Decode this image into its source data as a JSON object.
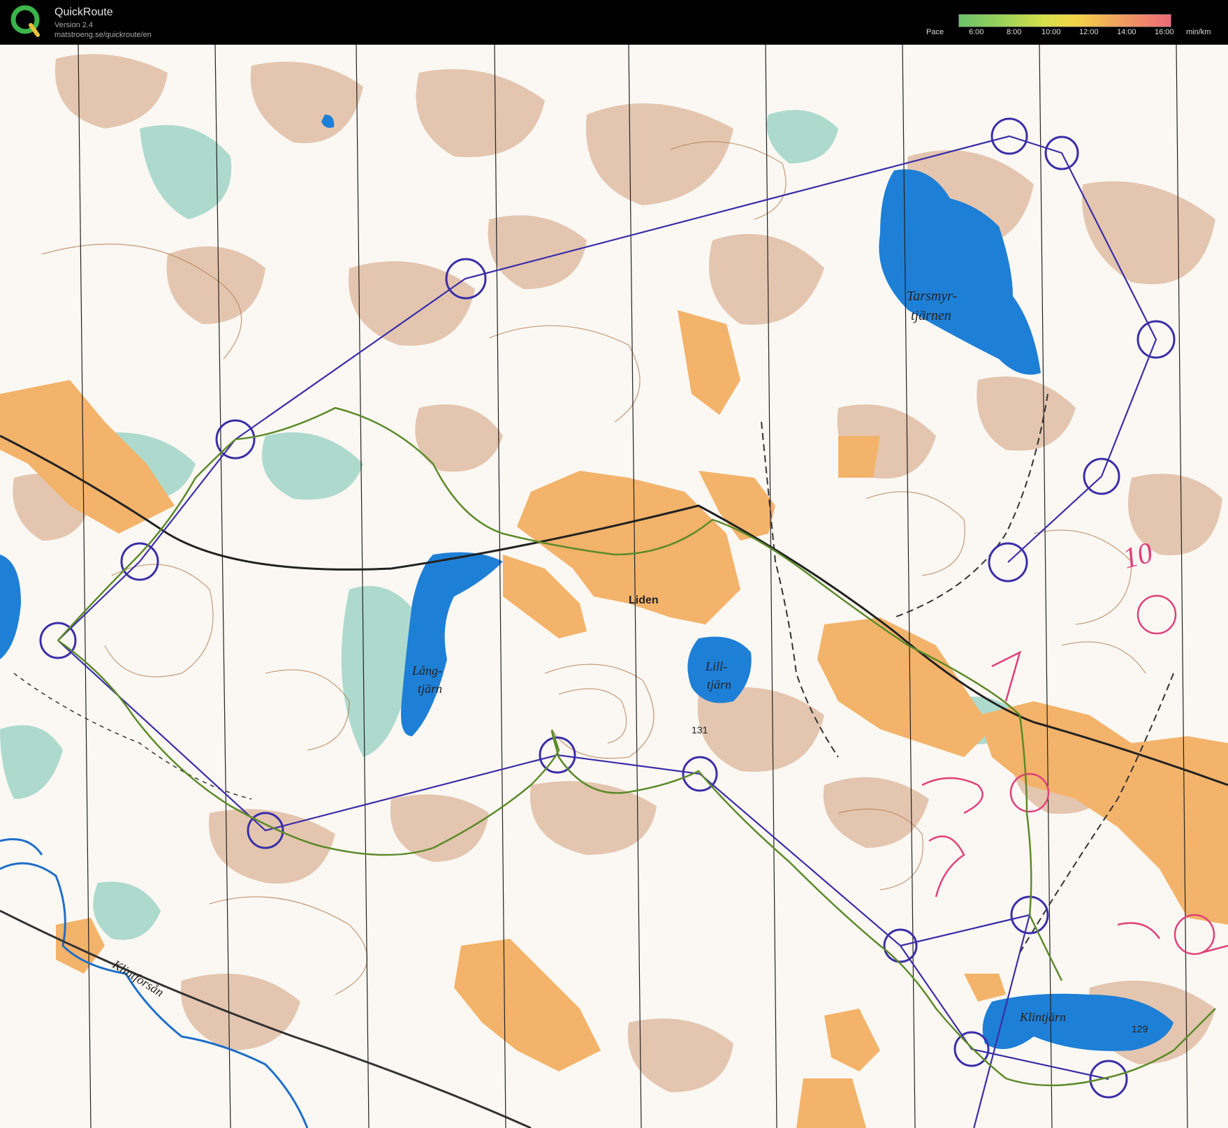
{
  "app": {
    "title": "QuickRoute",
    "version": "Version 2.4",
    "url": "matstroeng.se/quickroute/en"
  },
  "pace_legend": {
    "label": "Pace",
    "ticks": [
      "6:00",
      "8:00",
      "10:00",
      "12:00",
      "14:00",
      "16:00"
    ],
    "unit": "min/km",
    "colors": [
      "#6ac46a",
      "#d6e04a",
      "#f2a85a",
      "#ee6a7a"
    ]
  },
  "map": {
    "labels": {
      "tarsmyr_1": "Tarsmyr-",
      "tarsmyr_2": "tjärnen",
      "liden": "Liden",
      "lang_1": "Lång-",
      "lang_2": "tjärn",
      "lill_1": "Lill-",
      "lill_2": "tjärn",
      "height_131": "131",
      "klintjarn": "Klintjärn",
      "height_129": "129",
      "klintforsan": "Klintforsån",
      "pen_10": "10"
    },
    "colors": {
      "course": "#3a2ea8",
      "route": "#5d8a2a",
      "water": "#1e7fd6",
      "open": "#f3b36a",
      "contour": "#b07a50",
      "marsh": "#5fb8a8",
      "pen": "#e0407a"
    }
  }
}
